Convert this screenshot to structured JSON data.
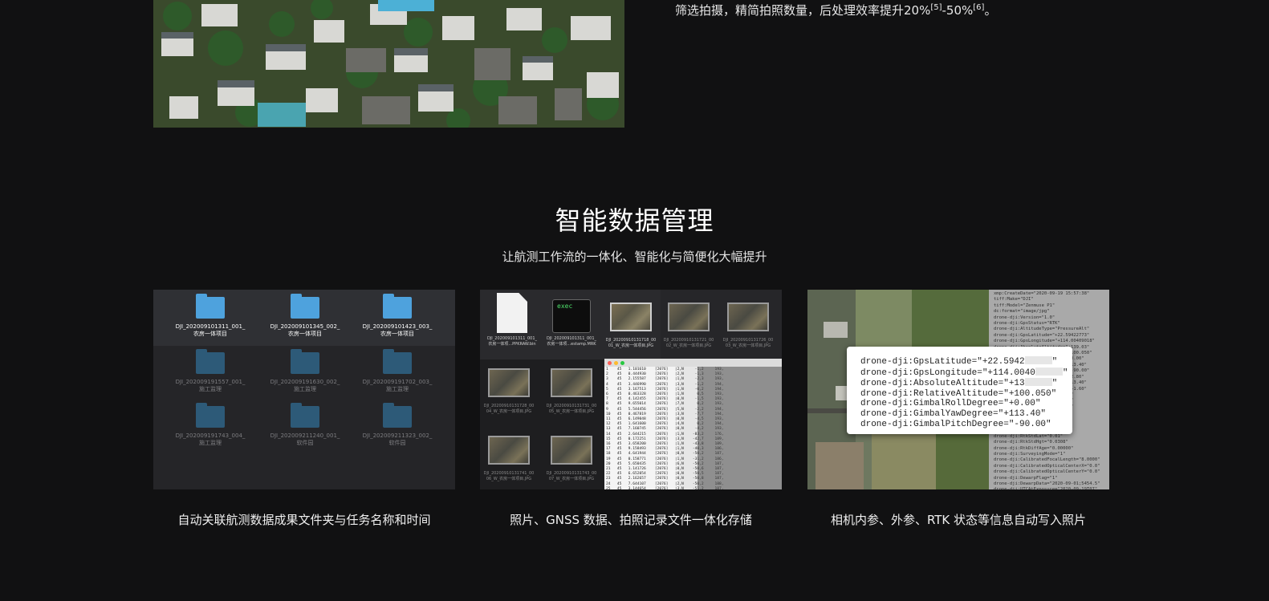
{
  "top": {
    "text_main": "筛选拍摄，精简拍照数量，后处理效率提升20%",
    "ref1": "[5]",
    "dash": "-50%",
    "ref2": "[6]",
    "end": "。"
  },
  "section": {
    "title": "智能数据管理",
    "subtitle": "让航测工作流的一体化、智能化与简便化大幅提升"
  },
  "cards": [
    {
      "caption": "自动关联航测数据成果文件夹与任务名称和时间",
      "folders": [
        {
          "line1": "DJI_202009101311_001_",
          "line2": "农房一体项目"
        },
        {
          "line1": "DJI_202009101345_002_",
          "line2": "农房一体项目"
        },
        {
          "line1": "DJI_202009101423_003_",
          "line2": "农房一体项目"
        },
        {
          "line1": "DJI_202009191557_001_",
          "line2": "施工监理"
        },
        {
          "line1": "DJI_202009191630_002_",
          "line2": "施工监理"
        },
        {
          "line1": "DJI_202009191702_003_",
          "line2": "施工监理"
        },
        {
          "line1": "DJI_202009191743_004_",
          "line2": "施工监理"
        },
        {
          "line1": "DJI_202009211240_001_",
          "line2": "软件园"
        },
        {
          "line1": "DJI_202009211323_002_",
          "line2": "软件园"
        }
      ]
    },
    {
      "caption": "照片、GNSS 数据、拍照记录文件一体化存储",
      "exec_label": "exec",
      "files": [
        {
          "line1": "DJI_202009101311_001_",
          "line2": "农房一体项...PPKRAW.bin"
        },
        {
          "line1": "DJI_202009101311_001_",
          "line2": "农房一体项...estamp.MRK"
        },
        {
          "line1": "DJI_20200910131718_00",
          "line2": "01_W_农房一体项目.JPG"
        },
        {
          "line1": "DJI_20200910131721_00",
          "line2": "02_W_农房一体项目.JPG"
        },
        {
          "line1": "DJI_20200910131726_00",
          "line2": "03_W_农房一体项目.JPG"
        },
        {
          "line1": "DJI_20200910131728_00",
          "line2": "04_W_农房一体项目.JPG"
        },
        {
          "line1": "DJI_20200910131731_00",
          "line2": "05_W_农房一体项目.JPG"
        },
        {
          "line1": "DJI_20200910131741_00",
          "line2": "06_W_农房一体项目.JPG"
        },
        {
          "line1": "DJI_20200910131743_00",
          "line2": "07_W_农房一体项目.JPG"
        }
      ],
      "terminal_text": "1    45   1.101610    [2076]   |2,N     -1,2     193,\n2    45   0.444930    [2076]   |2,N     -1,3     193,\n3    45   2.155587    [2076]   |1,N     -2,3     193,\n4    45   3.446990    [2076]   |3,N     -1,2     194,\n5    45   3.167513    [2076]   |1,N     -0,2     194,\n6    45   0.463328    [2076]   |1,N      0,5     193,\n7    45   4.142455    [2076]   |0,N     -1,5     193,\n8    45   9.655014    [2076]   |7,N      0,2     193,\n9    45   5.544456    [2076]   |5,N     -2,2     194,\n10   45   0.467819    [2076]   |3,N     -7,7     194,\n11   45   6.149048    [2076]   |0,N     -4,5     193,\n12   45   1.641600    [2076]   |4,N      0,2     194,\n13   45   7.160745    [2076]   |0,N     -4,2     193,\n14   45   2.644215    [2076]   |1,N    -83,2     176,\n15   45   0.172251    [2076]   |3,N    -42,7     189,\n16   45   3.658200    [2076]   |1,N    -43,8     189,\n17   45   9.158493    [2076]   |1,N    -40,3     186,\n18   45   4.641944    [2076]   |0,N    -50,2     187,\n19   45   0.158771    [2076]   |1,N    -31,2     186,\n20   45   5.650435    [2076]   |6,N    -50,2     187,\n21   45   1.141726    [2076]   |0,N    -50,6     187,\n22   45   6.652054    [2076]   |0,N    -50,5     187,\n23   45   2.162657    [2076]   |0,N    -50,8     187,\n24   45   7.644107    [2076]   |2,N    -50,2     188,\n25   45   3.144654    [2076]   |3,N    -51,2     187,\n26   45   8.962900    [2076]   |1,N    -50,5     187,\n27   45   4.162825    [2076]   |1,N    -50,8     187,"
    },
    {
      "caption": "相机内参、外参、RTK 状态等信息自动写入照片",
      "exif": [
        {
          "pre": "drone-dji:GpsLatitude=\"+22.5942",
          "post": "\""
        },
        {
          "pre": "drone-dji:GpsLongitude=\"+114.0040",
          "post": "\""
        },
        {
          "pre": "drone-dji:AbsoluteAltitude=\"+13",
          "post": "\""
        },
        {
          "pre": "drone-dji:RelativeAltitude=\"+100.050\"",
          "post": ""
        },
        {
          "pre": "drone-dji:GimbalRollDegree=\"+0.00\"",
          "post": ""
        },
        {
          "pre": "drone-dji:GimbalYawDegree=\"+113.40\"",
          "post": ""
        },
        {
          "pre": "drone-dji:GimbalPitchDegree=\"-90.00\"",
          "post": ""
        }
      ],
      "meta_text": "xmp:CreateDate=\"2020-09-19 15:57:38\"\ntiff:Make=\"DJI\"\ntiff:Model=\"Zenmuse P1\"\ndc:format=\"image/jpg\"\ndrone-dji:Version=\"1.0\"\ndrone-dji:GpsStatus=\"RTK\"\ndrone-dji:AltitudeType=\"PressureAlt\"\ndrone-dji:GpsLatitude=\"+22.59422773\"\ndrone-dji:GpsLongitude=\"+114.00409018\"\ndrone-dji:AbsoluteAltitude=\"+139.03\"\ndrone-dji:RelativeAltitude=\"+100.050\"\ndrone-dji:GimbalRollDegree=\"+0.00\"\ndrone-dji:GimbalYawDegree=\"+113.40\"\ndrone-dji:GimbalPitchDegree=\"-90.00\"\ndrone-dji:FlightRollDegree=\"+2.80\"\ndrone-dji:FlightYawDegree=\"+113.40\"\ndrone-dji:FlightPitchDegree=\"+1.60\"\ndrone-dji:FlightXSpeed=\"+0.00\"\ndrone-dji:FlightYSpeed=\"+0.00\"\ndrone-dji:FlightZSpeed=\"+0.00\"\ndrone-dji:CamReverse=\"0\"\ndrone-dji:GimbalReverse=\"0\"\ndrone-dji:RtkFlag=\"50\"\ndrone-dji:RtkStdLon=\"0.01\"\ndrone-dji:RtkStdLat=\"0.01\"\ndrone-dji:RtkStdHgt=\"0.0308\"\ndrone-dji:RtkDiffAge=\"0.00000\"\ndrone-dji:SurveyingMode=\"1\"\ndrone-dji:CalibratedFocalLength=\"8.0000\"\ndrone-dji:CalibratedOpticalCenterX=\"0.0\"\ndrone-dji:CalibratedOpticalCenterY=\"0.0\"\ndrone-dji:DewarpFlag=\"1\"\ndrone-dji:DewarpData=\"2020-09-01;5454.5\"\ndrone-dji:UTCAtExposure=\"2020-09-19T07\""
    }
  ]
}
